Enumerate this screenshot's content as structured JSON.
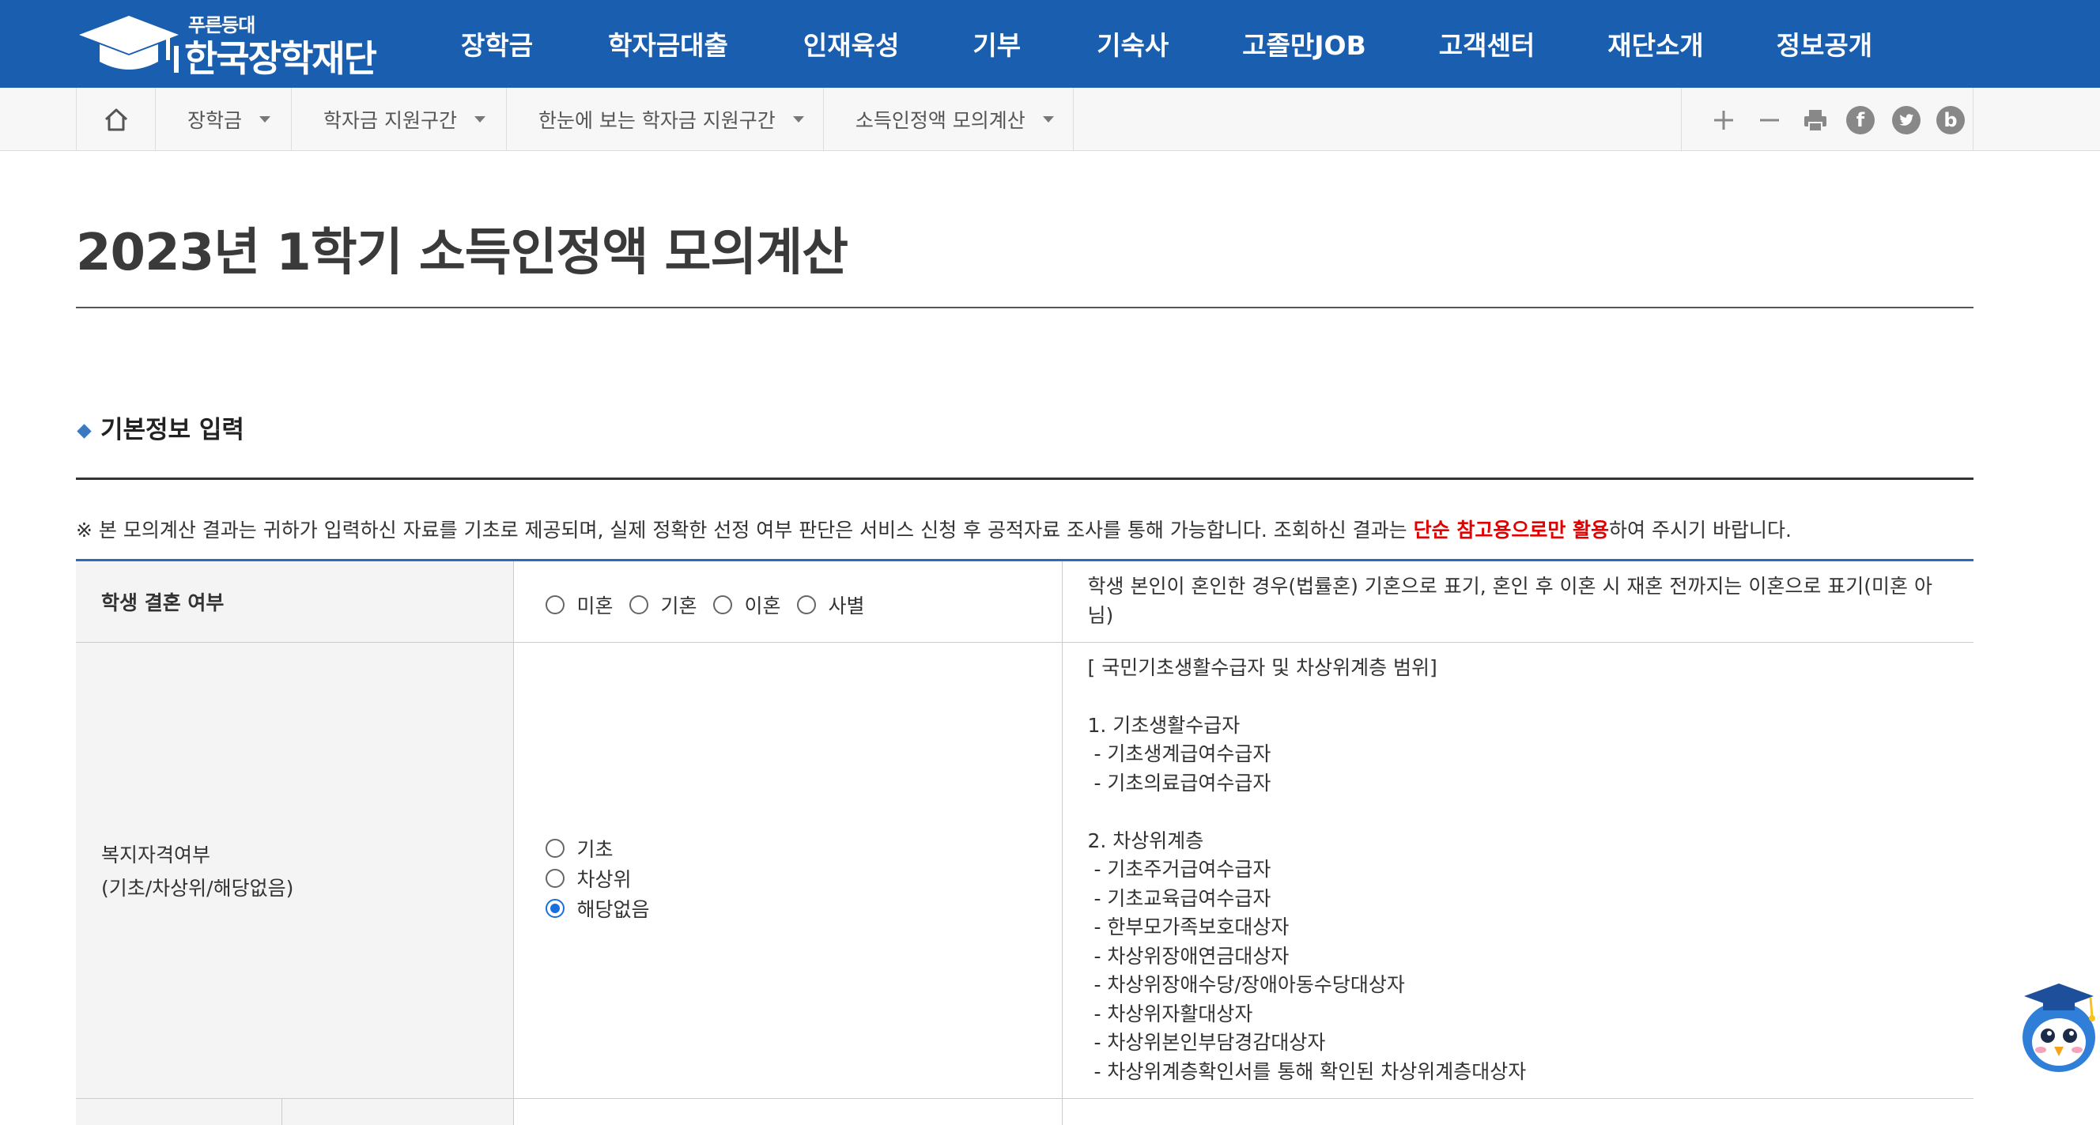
{
  "header": {
    "logo_sub": "푸른등대",
    "logo_main": "한국장학재단",
    "menu": [
      {
        "label": "장학금",
        "x": 0
      },
      {
        "label": "학자금대출"
      },
      {
        "label": "인재육성"
      },
      {
        "label": "기부"
      },
      {
        "label": "기숙사"
      },
      {
        "label": "고졸만JOB"
      },
      {
        "label": "고객센터"
      },
      {
        "label": "재단소개"
      },
      {
        "label": "정보공개"
      }
    ]
  },
  "breadcrumb": {
    "items": [
      "장학금",
      "학자금 지원구간",
      "한눈에 보는 학자금 지원구간",
      "소득인정액 모의계산"
    ]
  },
  "tools": {
    "zoom_in": "+",
    "zoom_out": "−",
    "facebook": "f",
    "blog": "b"
  },
  "page": {
    "title": "2023년 1학기 소득인정액 모의계산"
  },
  "section": {
    "title": "기본정보 입력"
  },
  "notice": {
    "pre": "※ 본 모의계산 결과는 귀하가 입력하신 자료를 기초로 제공되며, 실제 정확한 선정 여부 판단은 서비스 신청 후 공적자료 조사를 통해 가능합니다. 조회하신 결과는 ",
    "highlight": "단순 참고용으로만 활용",
    "post": "하여 주시기 바랍니다."
  },
  "form": {
    "marriage": {
      "label": "학생 결혼 여부",
      "options": [
        "미혼",
        "기혼",
        "이혼",
        "사별"
      ],
      "selected": null,
      "description": "학생 본인이 혼인한 경우(법률혼) 기혼으로 표기, 혼인 후 이혼 시 재혼 전까지는 이혼으로 표기(미혼 아님)"
    },
    "welfare": {
      "label_line1": "복지자격여부",
      "label_line2": "(기초/차상위/해당없음)",
      "options": [
        "기초",
        "차상위",
        "해당없음"
      ],
      "selected": "해당없음",
      "description_lines": [
        "[ 국민기초생활수급자 및 차상위계층 범위]",
        "",
        "1. 기초생활수급자",
        " - 기초생계급여수급자",
        " - 기초의료급여수급자",
        "",
        "2. 차상위계층",
        " - 기초주거급여수급자",
        " - 기초교육급여수급자",
        " - 한부모가족보호대상자",
        " - 차상위장애연금대상자",
        " - 차상위장애수당/장애아동수당대상자",
        " - 차상위자활대상자",
        " - 차상위본인부담경감대상자",
        " - 차상위계층확인서를 통해 확인된 차상위계층대상자"
      ]
    }
  },
  "colors": {
    "header_bg": "#1a5eb0",
    "table_top_border": "#2a6bbf",
    "highlight_red": "#e10000",
    "radio_checked": "#1a6fe0"
  }
}
